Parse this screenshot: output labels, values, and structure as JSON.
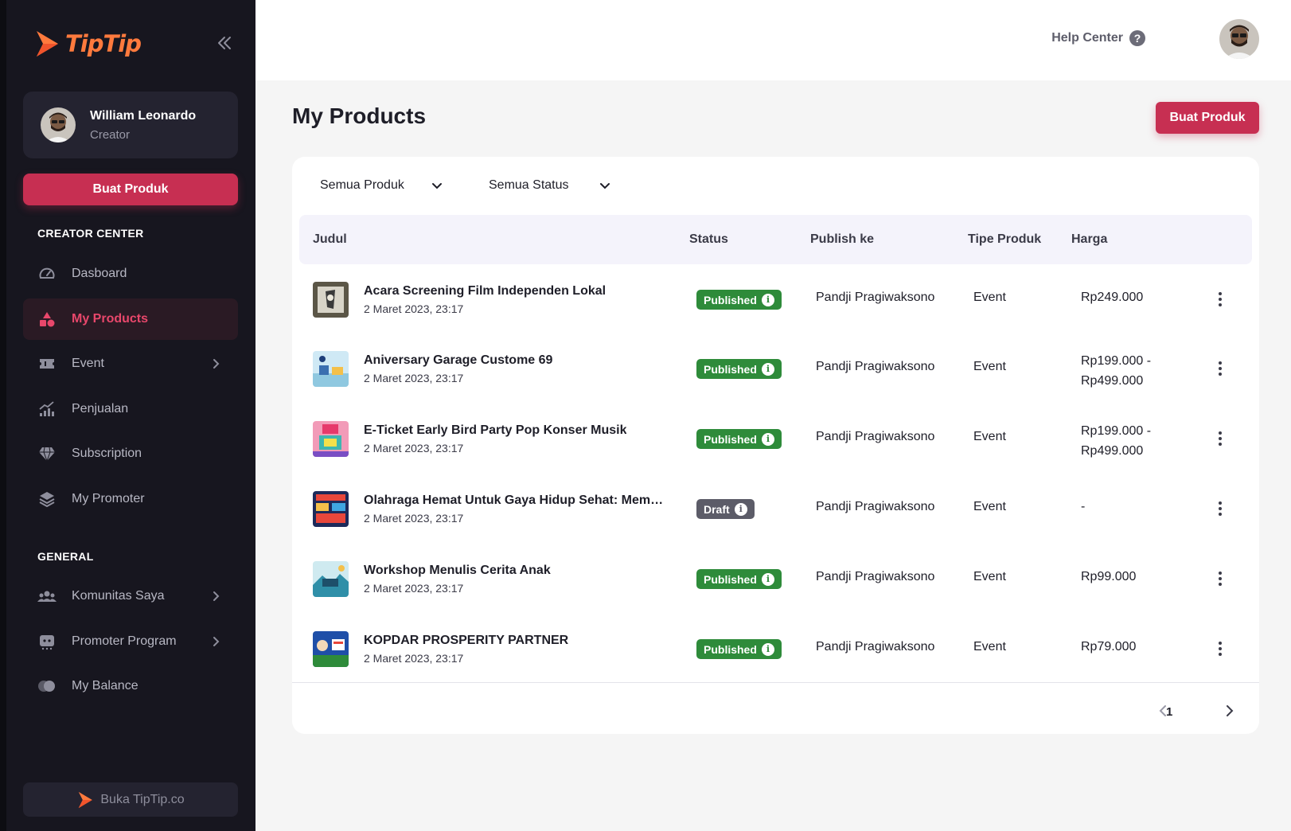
{
  "brand": {
    "name": "TipTip",
    "color": "#ff7a3d"
  },
  "colors": {
    "accent": "#c72f52",
    "published": "#2e8b3a",
    "draft": "#5c5c68",
    "sidebar_bg": "#17161f"
  },
  "sidebar": {
    "user": {
      "name": "William Leonardo",
      "role": "Creator"
    },
    "create_button": "Buat Produk",
    "sections": {
      "creator_center": "CREATOR CENTER",
      "general": "GENERAL"
    },
    "items": [
      {
        "label": "Dasboard",
        "icon": "dashboard-icon"
      },
      {
        "label": "My Products",
        "icon": "products-icon",
        "active": true
      },
      {
        "label": "Event",
        "icon": "ticket-icon",
        "has_submenu": true
      },
      {
        "label": "Penjualan",
        "icon": "sales-chart-icon"
      },
      {
        "label": "Subscription",
        "icon": "diamond-icon"
      },
      {
        "label": "My Promoter",
        "icon": "layers-icon"
      },
      {
        "label": "Komunitas Saya",
        "icon": "community-icon",
        "has_submenu": true
      },
      {
        "label": "Promoter Program",
        "icon": "promoter-icon",
        "has_submenu": true
      },
      {
        "label": "My Balance",
        "icon": "balance-icon"
      }
    ],
    "footer_link": "Buka TipTip.co"
  },
  "topbar": {
    "help_label": "Help Center"
  },
  "page": {
    "title": "My Products",
    "create_button": "Buat Produk",
    "filters": {
      "product": "Semua Produk",
      "status": "Semua Status"
    }
  },
  "table": {
    "columns": [
      "Judul",
      "Status",
      "Publish ke",
      "Tipe Produk",
      "Harga"
    ],
    "rows": [
      {
        "title": "Acara Screening Film Independen Lokal",
        "date": "2 Maret 2023, 23:17",
        "status": "Published",
        "publish_to": "Pandji Pragiwaksono",
        "type": "Event",
        "price": "Rp249.000",
        "price2": ""
      },
      {
        "title": "Aniversary Garage Custome 69",
        "date": "2 Maret 2023, 23:17",
        "status": "Published",
        "publish_to": "Pandji Pragiwaksono",
        "type": "Event",
        "price": "Rp199.000 -",
        "price2": "Rp499.000"
      },
      {
        "title": "E-Ticket Early Bird Party Pop Konser Musik",
        "date": "2 Maret 2023, 23:17",
        "status": "Published",
        "publish_to": "Pandji Pragiwaksono",
        "type": "Event",
        "price": "Rp199.000 -",
        "price2": "Rp499.000"
      },
      {
        "title": "Olahraga Hemat Untuk Gaya Hidup Sehat: Memb...",
        "date": "2 Maret 2023, 23:17",
        "status": "Draft",
        "publish_to": "Pandji Pragiwaksono",
        "type": "Event",
        "price": "-",
        "price2": ""
      },
      {
        "title": "Workshop Menulis Cerita Anak",
        "date": "2 Maret 2023, 23:17",
        "status": "Published",
        "publish_to": "Pandji Pragiwaksono",
        "type": "Event",
        "price": "Rp99.000",
        "price2": ""
      },
      {
        "title": "KOPDAR PROSPERITY PARTNER",
        "date": "2 Maret 2023, 23:17",
        "status": "Published",
        "publish_to": "Pandji Pragiwaksono",
        "type": "Event",
        "price": "Rp79.000",
        "price2": ""
      }
    ]
  },
  "pagination": {
    "current_page": "1"
  }
}
